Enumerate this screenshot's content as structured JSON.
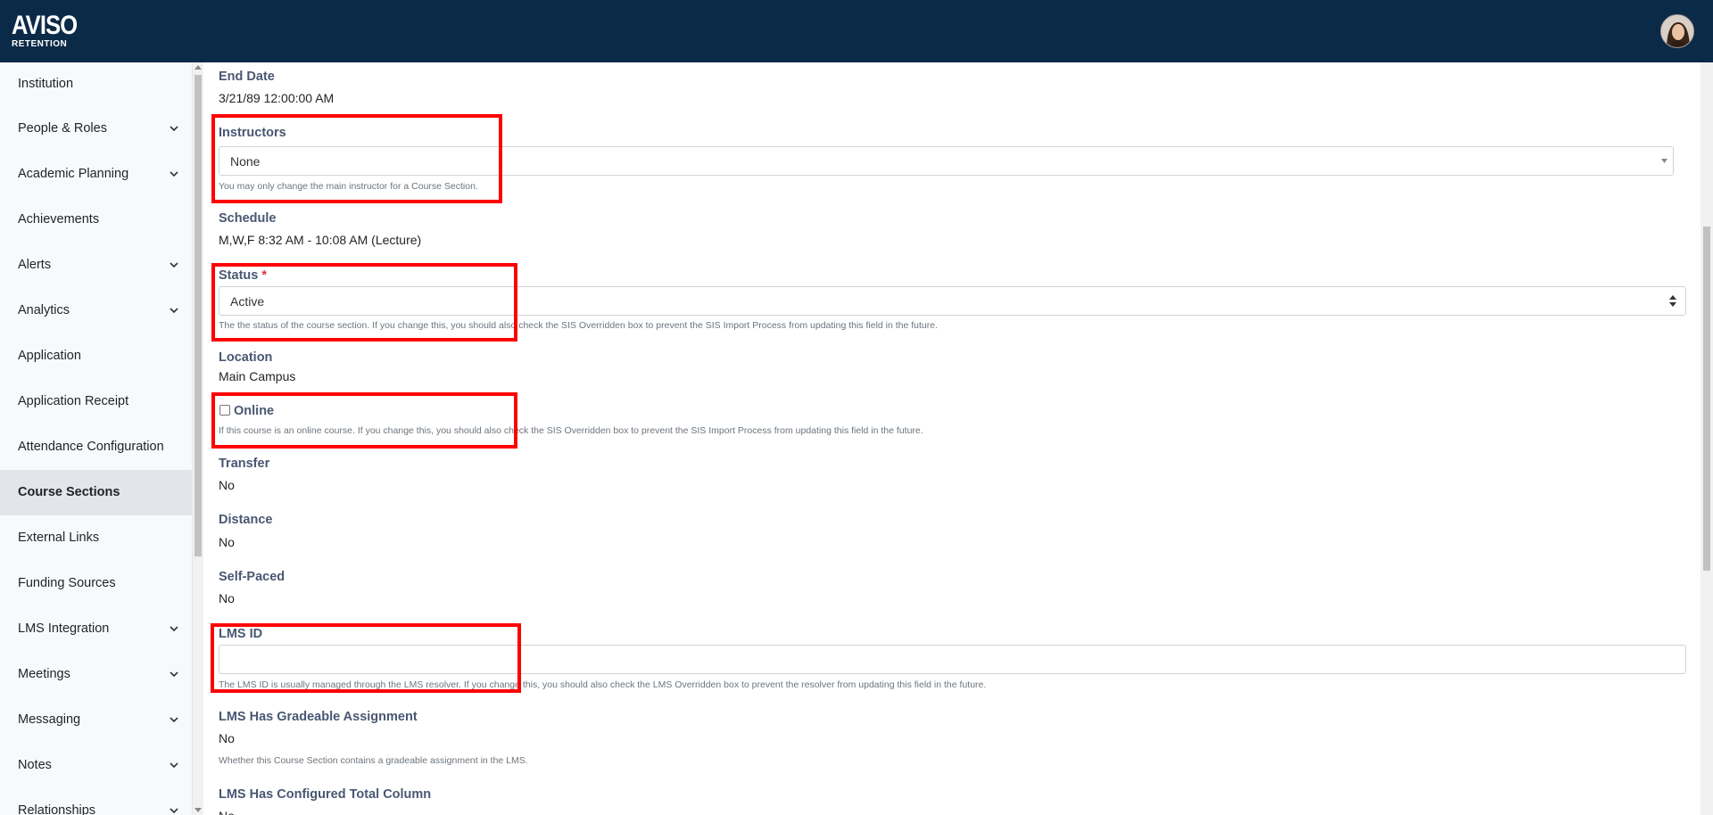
{
  "header": {
    "logo_top": "AVISO",
    "logo_bottom": "RETENTION"
  },
  "sidebar": {
    "items": [
      {
        "label": "Institution",
        "expandable": false
      },
      {
        "label": "People & Roles",
        "expandable": true
      },
      {
        "label": "Academic Planning",
        "expandable": true
      },
      {
        "label": "Achievements",
        "expandable": false
      },
      {
        "label": "Alerts",
        "expandable": true
      },
      {
        "label": "Analytics",
        "expandable": true
      },
      {
        "label": "Application",
        "expandable": false
      },
      {
        "label": "Application Receipt",
        "expandable": false
      },
      {
        "label": "Attendance Configuration",
        "expandable": false
      },
      {
        "label": "Course Sections",
        "expandable": false,
        "active": true
      },
      {
        "label": "External Links",
        "expandable": false
      },
      {
        "label": "Funding Sources",
        "expandable": false
      },
      {
        "label": "LMS Integration",
        "expandable": true
      },
      {
        "label": "Meetings",
        "expandable": true
      },
      {
        "label": "Messaging",
        "expandable": true
      },
      {
        "label": "Notes",
        "expandable": true
      },
      {
        "label": "Relationships",
        "expandable": true
      }
    ]
  },
  "form": {
    "end_date": {
      "label": "End Date",
      "value": "3/21/89 12:00:00 AM"
    },
    "instructors": {
      "label": "Instructors",
      "value": "None",
      "help": "You may only change the main instructor for a Course Section."
    },
    "schedule": {
      "label": "Schedule",
      "value": "M,W,F 8:32 AM - 10:08 AM (Lecture)"
    },
    "status": {
      "label": "Status",
      "required_mark": "*",
      "value": "Active",
      "help": "The the status of the course section. If you change this, you should also check the SIS Overridden box to prevent the SIS Import Process from updating this field in the future."
    },
    "location": {
      "label": "Location",
      "value": "Main Campus"
    },
    "online": {
      "label": "Online",
      "checked": false,
      "help": "If this course is an online course. If you change this, you should also check the SIS Overridden box to prevent the SIS Import Process from updating this field in the future."
    },
    "transfer": {
      "label": "Transfer",
      "value": "No"
    },
    "distance": {
      "label": "Distance",
      "value": "No"
    },
    "self_paced": {
      "label": "Self-Paced",
      "value": "No"
    },
    "lms_id": {
      "label": "LMS ID",
      "value": "",
      "help": "The LMS ID is usually managed through the LMS resolver. If you change this, you should also check the LMS Overridden box to prevent the resolver from updating this field in the future."
    },
    "lms_gradeable": {
      "label": "LMS Has Gradeable Assignment",
      "value": "No",
      "help": "Whether this Course Section contains a gradeable assignment in the LMS."
    },
    "lms_total_column": {
      "label": "LMS Has Configured Total Column",
      "value": "No"
    }
  },
  "colors": {
    "header_bg": "#0b2a47",
    "label": "#495772",
    "highlight": "#ff0000"
  }
}
